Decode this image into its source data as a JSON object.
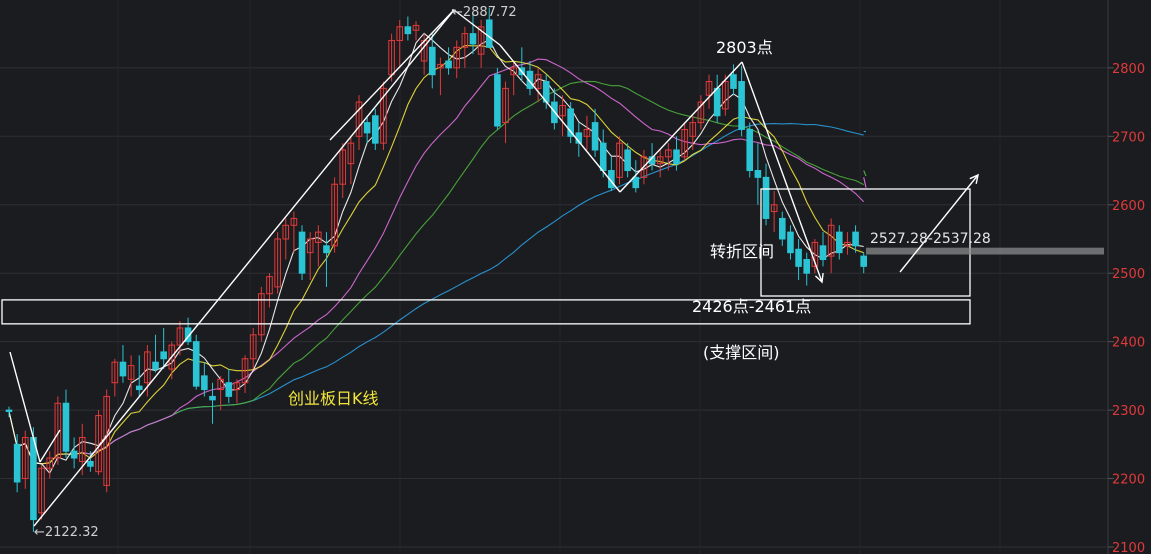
{
  "chart_data": {
    "type": "candlestick",
    "title": "创业板日K线",
    "ylim": [
      2100,
      2900
    ],
    "y_ticks": [
      2100,
      2200,
      2300,
      2400,
      2500,
      2600,
      2700,
      2800
    ],
    "colors": {
      "up": "#e03a3a",
      "down": "#2bc4d4",
      "ma5": "#ffffff",
      "ma10": "#f2e63a",
      "ma20": "#e06ee0",
      "ma30": "#4caf3c",
      "ma60": "#2a9fe0",
      "axis_text": "#e03a3a",
      "annotation": "#ffffff",
      "title_text": "#f2e63a"
    },
    "candles": [
      [
        2300,
        2305,
        2290,
        2298
      ],
      [
        2250,
        2265,
        2180,
        2195
      ],
      [
        2200,
        2270,
        2185,
        2260
      ],
      [
        2260,
        2275,
        2122,
        2140
      ],
      [
        2150,
        2220,
        2140,
        2215
      ],
      [
        2215,
        2240,
        2200,
        2230
      ],
      [
        2230,
        2320,
        2220,
        2310
      ],
      [
        2310,
        2330,
        2230,
        2240
      ],
      [
        2240,
        2260,
        2215,
        2230
      ],
      [
        2225,
        2280,
        2205,
        2260
      ],
      [
        2225,
        2240,
        2210,
        2218
      ],
      [
        2210,
        2300,
        2205,
        2292
      ],
      [
        2190,
        2330,
        2180,
        2320
      ],
      [
        2340,
        2375,
        2320,
        2370
      ],
      [
        2370,
        2395,
        2340,
        2350
      ],
      [
        2345,
        2380,
        2320,
        2365
      ],
      [
        2335,
        2380,
        2320,
        2330
      ],
      [
        2340,
        2395,
        2320,
        2385
      ],
      [
        2370,
        2410,
        2355,
        2360
      ],
      [
        2385,
        2420,
        2360,
        2375
      ],
      [
        2360,
        2400,
        2345,
        2395
      ],
      [
        2395,
        2430,
        2380,
        2420
      ],
      [
        2420,
        2435,
        2395,
        2400
      ],
      [
        2400,
        2410,
        2330,
        2335
      ],
      [
        2350,
        2370,
        2320,
        2330
      ],
      [
        2320,
        2340,
        2280,
        2315
      ],
      [
        2330,
        2350,
        2300,
        2345
      ],
      [
        2340,
        2360,
        2310,
        2320
      ],
      [
        2330,
        2345,
        2310,
        2340
      ],
      [
        2340,
        2380,
        2325,
        2375
      ],
      [
        2375,
        2420,
        2360,
        2410
      ],
      [
        2410,
        2480,
        2400,
        2470
      ],
      [
        2470,
        2500,
        2450,
        2495
      ],
      [
        2480,
        2560,
        2470,
        2550
      ],
      [
        2550,
        2580,
        2520,
        2570
      ],
      [
        2570,
        2590,
        2530,
        2580
      ],
      [
        2560,
        2570,
        2490,
        2500
      ],
      [
        2530,
        2560,
        2490,
        2550
      ],
      [
        2545,
        2570,
        2510,
        2560
      ],
      [
        2540,
        2560,
        2480,
        2530
      ],
      [
        2540,
        2640,
        2530,
        2630
      ],
      [
        2630,
        2690,
        2610,
        2680
      ],
      [
        2660,
        2700,
        2630,
        2690
      ],
      [
        2700,
        2760,
        2680,
        2750
      ],
      [
        2720,
        2730,
        2690,
        2705
      ],
      [
        2730,
        2740,
        2680,
        2690
      ],
      [
        2690,
        2780,
        2680,
        2770
      ],
      [
        2790,
        2850,
        2780,
        2840
      ],
      [
        2840,
        2870,
        2800,
        2860
      ],
      [
        2860,
        2875,
        2840,
        2850
      ],
      [
        2855,
        2868,
        2840,
        2862
      ],
      [
        2810,
        2850,
        2790,
        2840
      ],
      [
        2830,
        2850,
        2770,
        2790
      ],
      [
        2800,
        2815,
        2760,
        2805
      ],
      [
        2810,
        2830,
        2790,
        2800
      ],
      [
        2800,
        2840,
        2785,
        2830
      ],
      [
        2830,
        2860,
        2800,
        2850
      ],
      [
        2850,
        2880,
        2820,
        2835
      ],
      [
        2820,
        2870,
        2800,
        2860
      ],
      [
        2870,
        2887.72,
        2830,
        2830
      ],
      [
        2790,
        2800,
        2710,
        2715
      ],
      [
        2720,
        2780,
        2690,
        2770
      ],
      [
        2790,
        2810,
        2760,
        2800
      ],
      [
        2800,
        2830,
        2780,
        2790
      ],
      [
        2795,
        2810,
        2760,
        2770
      ],
      [
        2770,
        2800,
        2750,
        2790
      ],
      [
        2780,
        2790,
        2740,
        2750
      ],
      [
        2750,
        2770,
        2710,
        2720
      ],
      [
        2730,
        2760,
        2700,
        2745
      ],
      [
        2740,
        2750,
        2690,
        2700
      ],
      [
        2705,
        2720,
        2670,
        2690
      ],
      [
        2700,
        2730,
        2680,
        2710
      ],
      [
        2720,
        2740,
        2670,
        2680
      ],
      [
        2690,
        2710,
        2640,
        2650
      ],
      [
        2650,
        2670,
        2620,
        2625
      ],
      [
        2640,
        2700,
        2630,
        2690
      ],
      [
        2680,
        2690,
        2640,
        2650
      ],
      [
        2640,
        2665,
        2618,
        2625
      ],
      [
        2640,
        2680,
        2630,
        2670
      ],
      [
        2670,
        2690,
        2650,
        2660
      ],
      [
        2660,
        2680,
        2640,
        2670
      ],
      [
        2670,
        2690,
        2650,
        2680
      ],
      [
        2680,
        2700,
        2650,
        2660
      ],
      [
        2670,
        2720,
        2665,
        2710
      ],
      [
        2700,
        2730,
        2680,
        2720
      ],
      [
        2720,
        2760,
        2710,
        2750
      ],
      [
        2760,
        2790,
        2740,
        2780
      ],
      [
        2770,
        2790,
        2720,
        2730
      ],
      [
        2740,
        2790,
        2730,
        2780
      ],
      [
        2790,
        2805,
        2760,
        2770
      ],
      [
        2780,
        2803,
        2700,
        2710
      ],
      [
        2710,
        2720,
        2640,
        2650
      ],
      [
        2650,
        2690,
        2600,
        2640
      ],
      [
        2640,
        2660,
        2570,
        2580
      ],
      [
        2590,
        2620,
        2560,
        2600
      ],
      [
        2580,
        2590,
        2540,
        2550
      ],
      [
        2560,
        2570,
        2520,
        2530
      ],
      [
        2535,
        2550,
        2490,
        2510
      ],
      [
        2520,
        2530,
        2482,
        2500
      ],
      [
        2510,
        2550,
        2500,
        2545
      ],
      [
        2540,
        2560,
        2510,
        2520
      ],
      [
        2525,
        2580,
        2500,
        2570
      ],
      [
        2560,
        2570,
        2520,
        2530
      ],
      [
        2540,
        2560,
        2527,
        2545
      ],
      [
        2560,
        2570,
        2530,
        2540
      ],
      [
        2525,
        2530,
        2500,
        2510
      ]
    ],
    "annotations": {
      "high_label": "←2887.72",
      "low_label": "←2122.32",
      "peak2_label": "2803点",
      "resistance_label": "2527.28-2537.28",
      "turning_label": "转折区间",
      "support_label": "2426点-2461点",
      "support_sub_label": "(支撑区间)",
      "chart_label": "创业板日K线"
    },
    "levels": {
      "support_low": 2426,
      "support_high": 2461,
      "resistance_low": 2527.28,
      "resistance_high": 2537.28,
      "peak_high": 2887.72,
      "low_point": 2122.32,
      "peak2": 2803
    }
  }
}
